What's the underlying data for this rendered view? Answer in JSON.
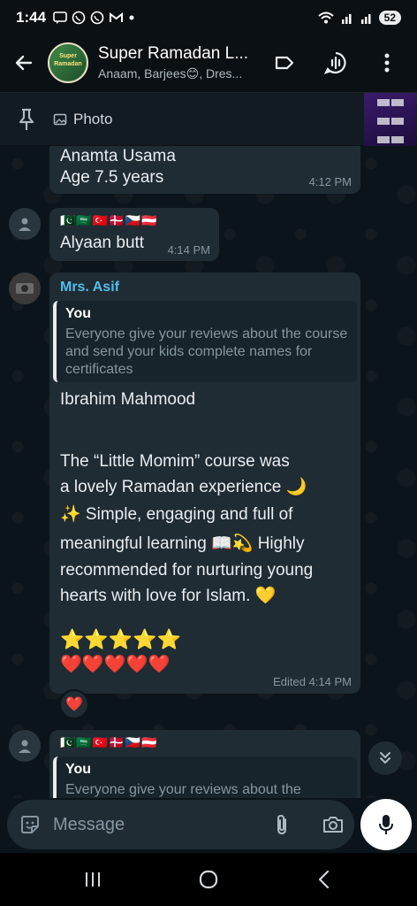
{
  "status": {
    "time": "1:44",
    "left_icons": [
      "sms-icon",
      "whatsapp-icon",
      "whatsapp-icon",
      "gmail-icon",
      "dot"
    ],
    "battery": "52"
  },
  "header": {
    "title": "Super Ramadan L...",
    "subtitle": "Anaam, Barjees😊, Dres...",
    "avatar_text": "Super Ramadan"
  },
  "pinned": {
    "label": "Photo"
  },
  "messages": [
    {
      "name": "Anamta Usama",
      "age": "Age 7.5 years",
      "time": "4:12 PM"
    },
    {
      "flags": "🇵🇰🇸🇦🇹🇷🇩🇰🇨🇿🇦🇹",
      "text": "Alyaan butt",
      "time": "4:14 PM"
    },
    {
      "sender": "Mrs. Asif",
      "quote_author": "You",
      "quote_text": "Everyone give your reviews about the course and send your kids complete names for certificates",
      "line1": "Ibrahim Mahmood",
      "line2": "The “Little Momim” course was",
      "line3": "a lovely Ramadan experience 🌙",
      "line4": "✨ Simple, engaging and full of",
      "line5": "meaningful learning 📖💫 Highly",
      "line6": "recommended for nurturing young",
      "line7": "hearts with love for Islam. 💛",
      "stars": "⭐⭐⭐⭐⭐",
      "hearts": "❤️❤️❤️❤️❤️",
      "time": "Edited 4:14 PM",
      "reaction": "❤️"
    },
    {
      "flags": "🇵🇰🇸🇦🇹🇷🇩🇰🇨🇿🇦🇹",
      "quote_author": "You",
      "quote_text": "Everyone give your reviews about the"
    }
  ],
  "input": {
    "placeholder": "Message"
  },
  "colors": {
    "sender_name": "#53bdeb",
    "bubble": "#1f2c34",
    "background": "#0b141a"
  }
}
